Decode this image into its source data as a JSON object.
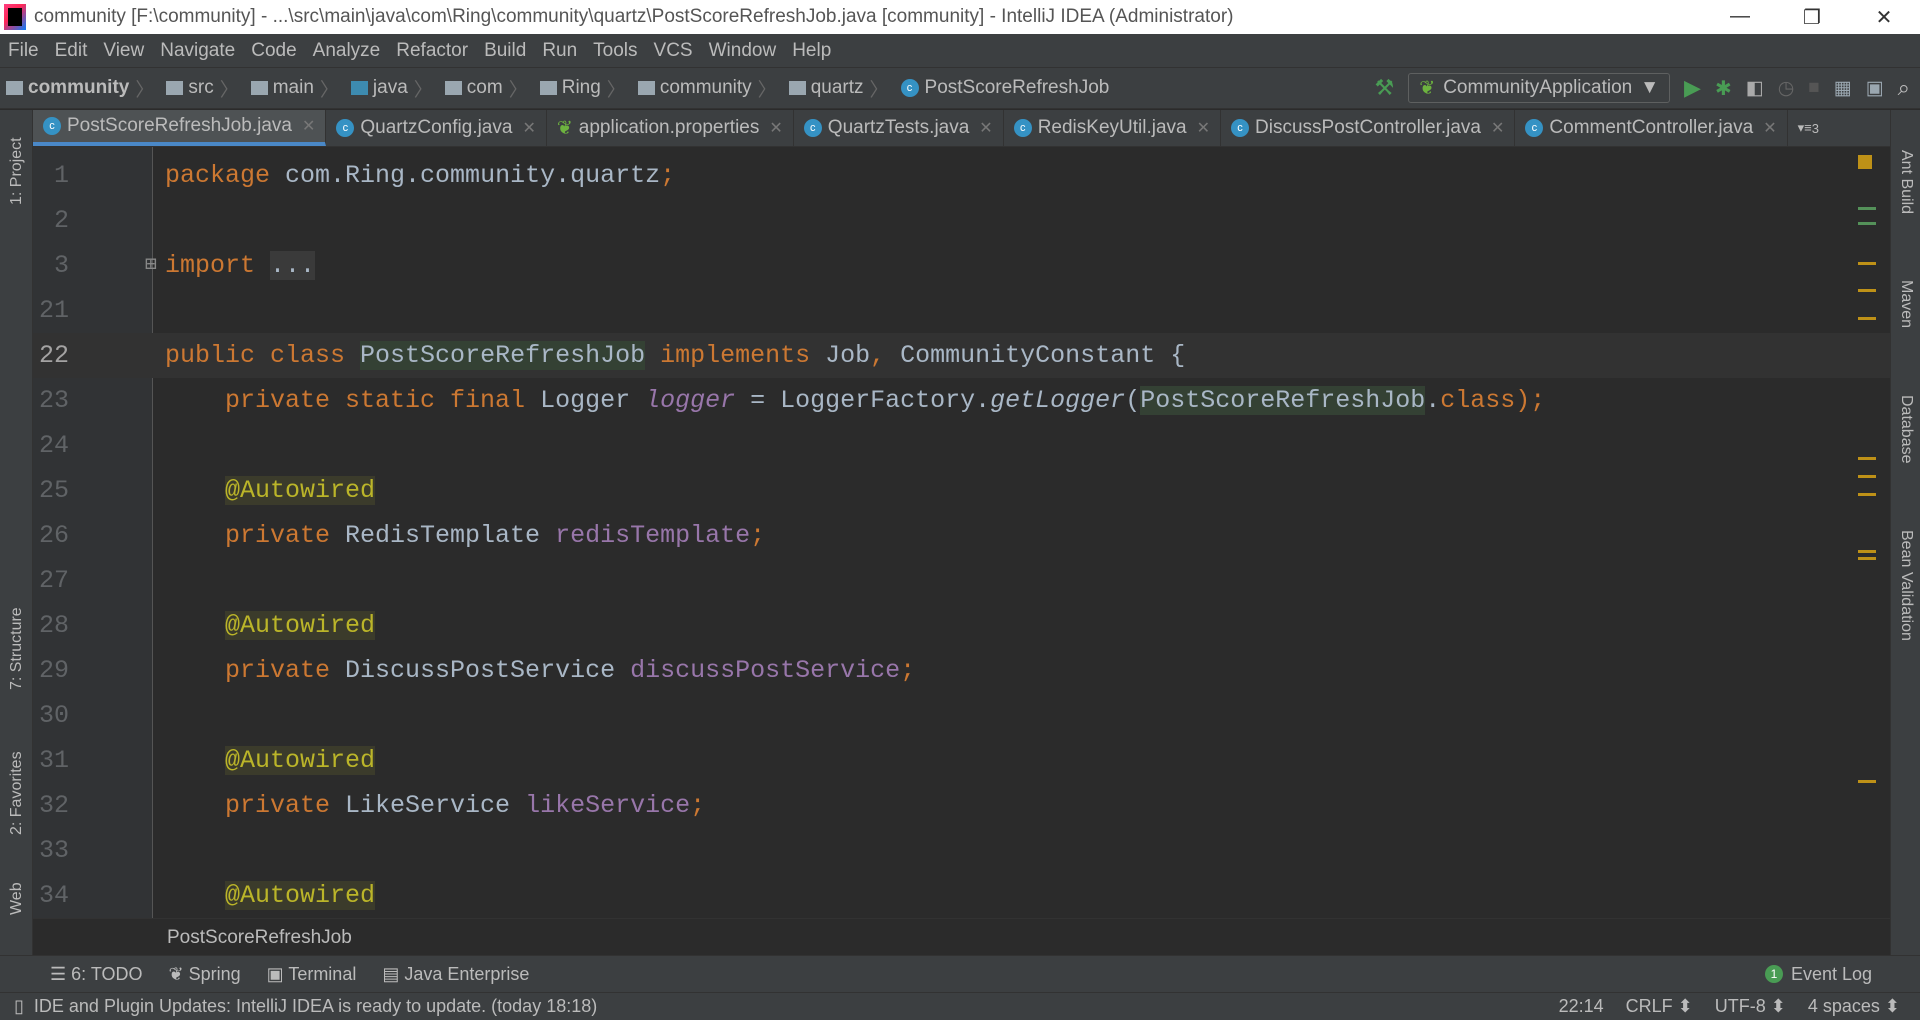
{
  "window": {
    "title": "community [F:\\community] - ...\\src\\main\\java\\com\\Ring\\community\\quartz\\PostScoreRefreshJob.java [community] - IntelliJ IDEA (Administrator)"
  },
  "menu": [
    "File",
    "Edit",
    "View",
    "Navigate",
    "Code",
    "Analyze",
    "Refactor",
    "Build",
    "Run",
    "Tools",
    "VCS",
    "Window",
    "Help"
  ],
  "breadcrumb": [
    "community",
    "src",
    "main",
    "java",
    "com",
    "Ring",
    "community",
    "quartz",
    "PostScoreRefreshJob"
  ],
  "run_config": "CommunityApplication",
  "tabs": [
    {
      "label": "PostScoreRefreshJob.java",
      "active": true
    },
    {
      "label": "QuartzConfig.java"
    },
    {
      "label": "application.properties"
    },
    {
      "label": "QuartzTests.java"
    },
    {
      "label": "RedisKeyUtil.java"
    },
    {
      "label": "DiscussPostController.java"
    },
    {
      "label": "CommentController.java"
    }
  ],
  "tabs_overflow": "3",
  "left_tools": [
    "1: Project",
    "7: Structure",
    "2: Favorites",
    "Web"
  ],
  "right_tools": [
    "Ant Build",
    "Maven",
    "Database",
    "Bean Validation"
  ],
  "code": [
    {
      "n": "1",
      "tokens": [
        [
          "package ",
          "kw"
        ],
        [
          "com.Ring.community.quartz",
          ""
        ],
        [
          ";",
          "kw"
        ]
      ]
    },
    {
      "n": "2",
      "tokens": []
    },
    {
      "n": "3",
      "tokens": [
        [
          "import ",
          "kw"
        ],
        [
          "...",
          "fold"
        ]
      ]
    },
    {
      "n": "21",
      "tokens": []
    },
    {
      "n": "22",
      "current": true,
      "tokens": [
        [
          "public class ",
          "kw"
        ],
        [
          "PostScoreRefreshJob",
          "hl"
        ],
        [
          " implements ",
          "kw"
        ],
        [
          "Job",
          ""
        ],
        [
          ", ",
          "kw"
        ],
        [
          "CommunityConstant {",
          ""
        ]
      ]
    },
    {
      "n": "23",
      "tokens": [
        [
          "    private static final ",
          "kw"
        ],
        [
          "Logger ",
          ""
        ],
        [
          "logger",
          "fi"
        ],
        [
          " = LoggerFactory.",
          ""
        ],
        [
          "getLogger",
          "it"
        ],
        [
          "(",
          ""
        ],
        [
          "PostScoreRefreshJob",
          "hl"
        ],
        [
          ".",
          ""
        ],
        [
          "class",
          "kw"
        ],
        [
          ");",
          "kw"
        ]
      ]
    },
    {
      "n": "24",
      "tokens": []
    },
    {
      "n": "25",
      "tokens": [
        [
          "    ",
          ""
        ],
        [
          "@Autowired",
          "an"
        ]
      ]
    },
    {
      "n": "26",
      "tokens": [
        [
          "    private ",
          "kw"
        ],
        [
          "RedisTemplate ",
          ""
        ],
        [
          "redisTemplate",
          "fd"
        ],
        [
          ";",
          "kw"
        ]
      ]
    },
    {
      "n": "27",
      "tokens": []
    },
    {
      "n": "28",
      "tokens": [
        [
          "    ",
          ""
        ],
        [
          "@Autowired",
          "an"
        ]
      ]
    },
    {
      "n": "29",
      "tokens": [
        [
          "    private ",
          "kw"
        ],
        [
          "DiscussPostService ",
          ""
        ],
        [
          "discussPostService",
          "fd"
        ],
        [
          ";",
          "kw"
        ]
      ]
    },
    {
      "n": "30",
      "tokens": []
    },
    {
      "n": "31",
      "tokens": [
        [
          "    ",
          ""
        ],
        [
          "@Autowired",
          "an"
        ]
      ]
    },
    {
      "n": "32",
      "tokens": [
        [
          "    private ",
          "kw"
        ],
        [
          "LikeService ",
          ""
        ],
        [
          "likeService",
          "fd"
        ],
        [
          ";",
          "kw"
        ]
      ]
    },
    {
      "n": "33",
      "tokens": []
    },
    {
      "n": "34",
      "tokens": [
        [
          "    ",
          ""
        ],
        [
          "@Autowired",
          "an"
        ]
      ]
    }
  ],
  "editor_breadcrumb": "PostScoreRefreshJob",
  "bottom_tools": [
    "6: TODO",
    "Spring",
    "Terminal",
    "Java Enterprise"
  ],
  "event_log": {
    "label": "Event Log",
    "count": "1"
  },
  "status": {
    "message": "IDE and Plugin Updates: IntelliJ IDEA is ready to update. (today 18:18)",
    "position": "22:14",
    "line_sep": "CRLF",
    "encoding": "UTF-8",
    "indent": "4 spaces"
  },
  "colors": {
    "keyword": "#cc7832",
    "annotation": "#bbb529",
    "field": "#9876aa",
    "text": "#a9b7c6",
    "background": "#2b2b2b"
  }
}
